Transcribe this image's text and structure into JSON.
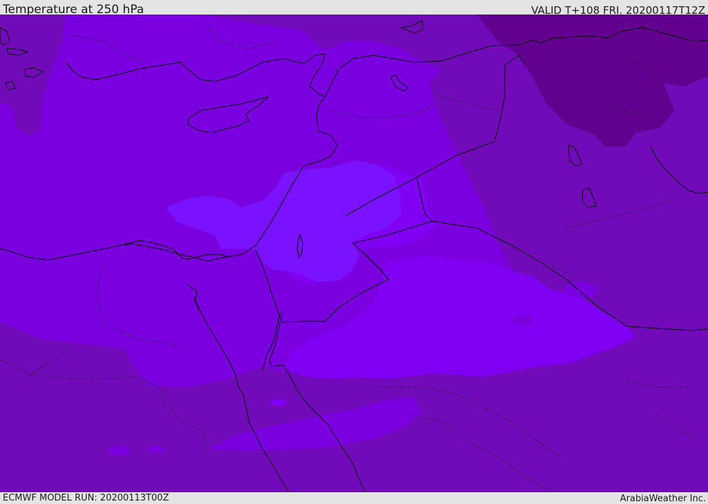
{
  "header": {
    "title": "Temperature at 250 hPa",
    "valid_time": "VALID T+108 FRI. 20200117T12Z"
  },
  "footer": {
    "model_run": "ECMWF MODEL RUN: 20200113T00Z",
    "credit": "ArabiaWeather Inc."
  },
  "map": {
    "fill_colors": {
      "deep": "#620090",
      "dark": "#710ab8",
      "mid": "#7a00e0",
      "bright": "#8000f4",
      "brightest": "#7a11ff"
    },
    "coastline_color": "#000000",
    "border_color": "#000000"
  }
}
